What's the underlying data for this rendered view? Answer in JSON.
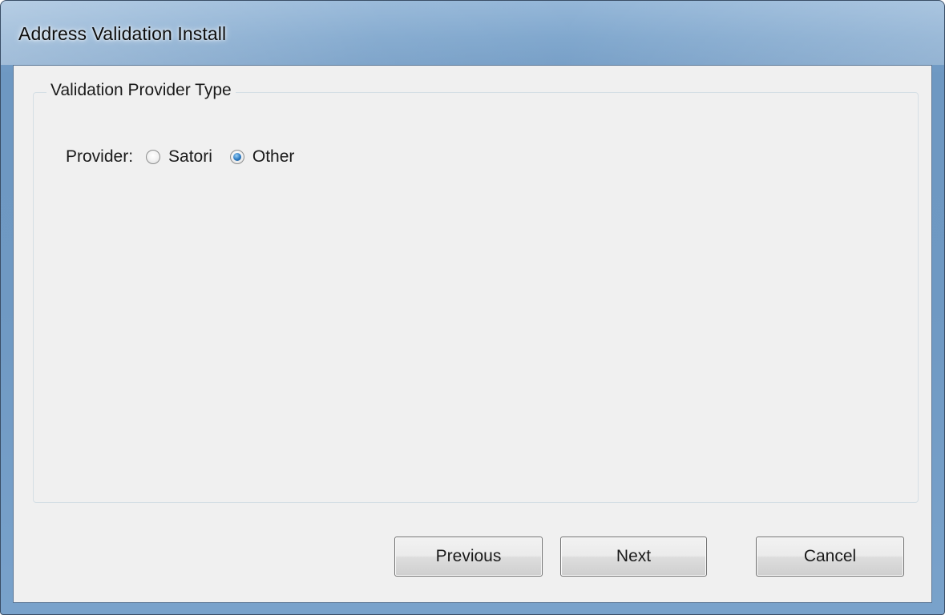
{
  "window": {
    "title": "Address Validation Install"
  },
  "group": {
    "legend": "Validation Provider Type"
  },
  "provider": {
    "label": "Provider:",
    "options": [
      {
        "label": "Satori",
        "checked": false
      },
      {
        "label": "Other",
        "checked": true
      }
    ]
  },
  "buttons": {
    "previous": "Previous",
    "next": "Next",
    "cancel": "Cancel"
  },
  "colors": {
    "titlebar_accent": "#6f99c3",
    "client_background": "#f0f0f0",
    "radio_checked": "#2a78c0"
  }
}
